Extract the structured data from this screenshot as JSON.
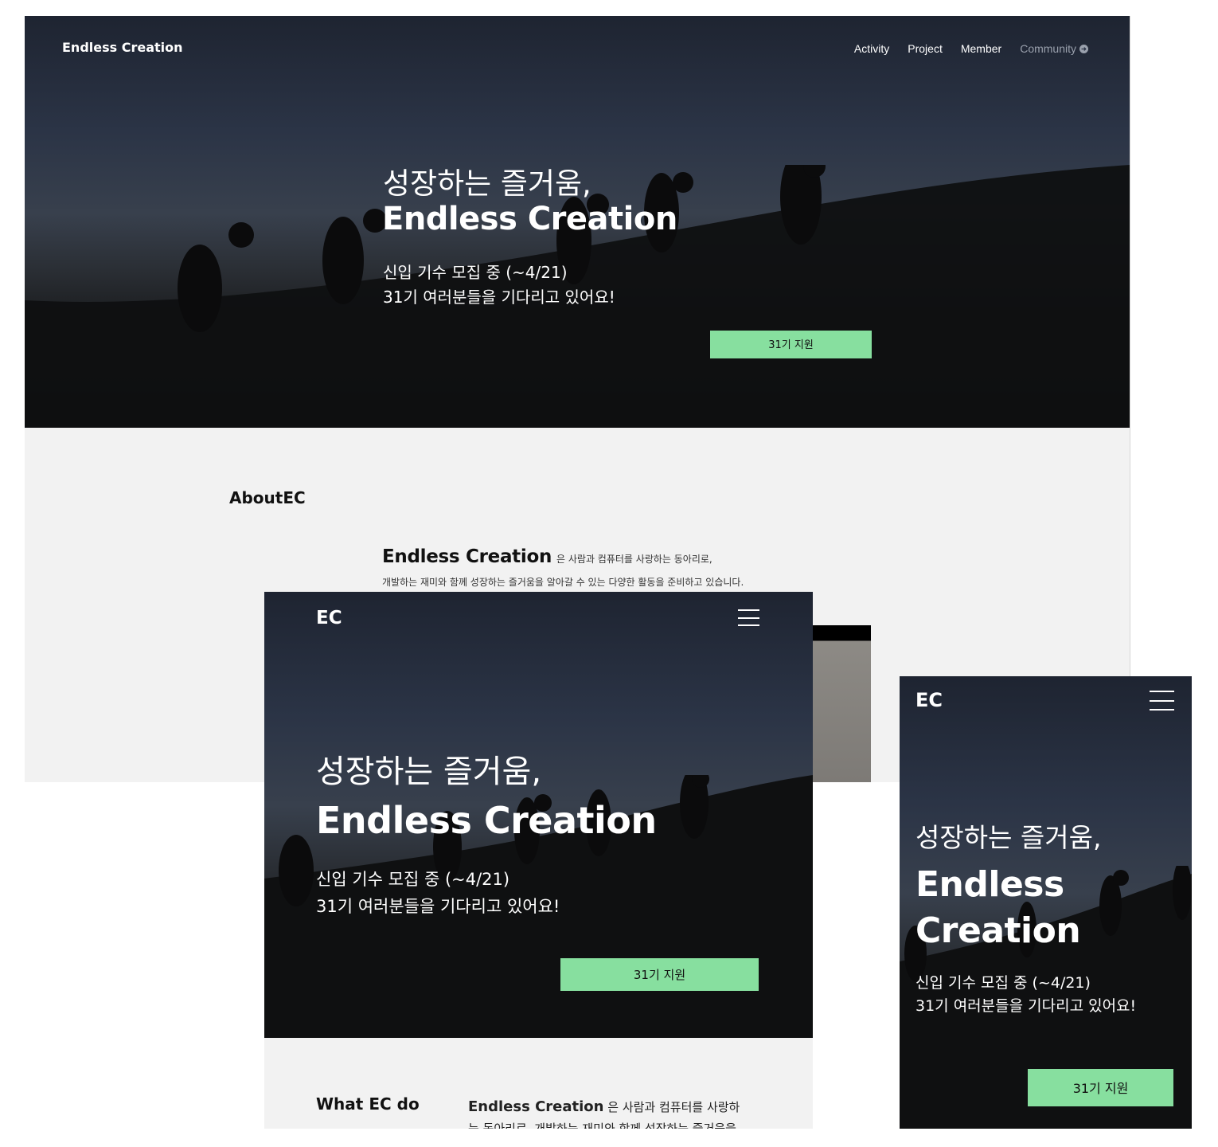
{
  "desktop": {
    "logo": "Endless Creation",
    "nav": {
      "activity": "Activity",
      "project": "Project",
      "member": "Member",
      "community": "Community"
    },
    "hero": {
      "headline": "성장하는 즐거움,",
      "title": "Endless Creation",
      "sub1": "신입 기수 모집 중 (~4/21)",
      "sub2": "31기 여러분들을 기다리고 있어요!",
      "cta": "31기 지원"
    },
    "about": {
      "title": "AboutEC",
      "brand": "Endless Creation",
      "line1_rest": "은 사람과 컴퓨터를 사랑하는 동아리로,",
      "line2": "개발하는 재미와 함께 성장하는 즐거움을 알아갈 수 있는 다양한 활동을 준비하고 있습니다."
    }
  },
  "tablet": {
    "logo": "EC",
    "hero": {
      "headline": "성장하는 즐거움,",
      "title": "Endless Creation",
      "sub1": "신입 기수 모집 중 (~4/21)",
      "sub2": "31기 여러분들을 기다리고 있어요!",
      "cta": "31기 지원"
    },
    "what": {
      "title": "What EC do",
      "brand": "Endless Creation",
      "desc_rest": "은 사람과 컴퓨터를 사랑하",
      "desc_line2": "는 동아리로, 개발하는 재미와 함께 성장하는 즐거움을"
    }
  },
  "mobile": {
    "logo": "EC",
    "hero": {
      "headline": "성장하는 즐거움,",
      "title": "Endless Creation",
      "sub1": "신입 기수 모집 중 (~4/21)",
      "sub2": "31기 여러분들을 기다리고 있어요!",
      "cta": "31기 지원"
    }
  },
  "colors": {
    "accent": "#87df9f",
    "hero_top": "#1e2431",
    "hero_bottom": "#101010",
    "section_bg": "#f2f2f2"
  }
}
